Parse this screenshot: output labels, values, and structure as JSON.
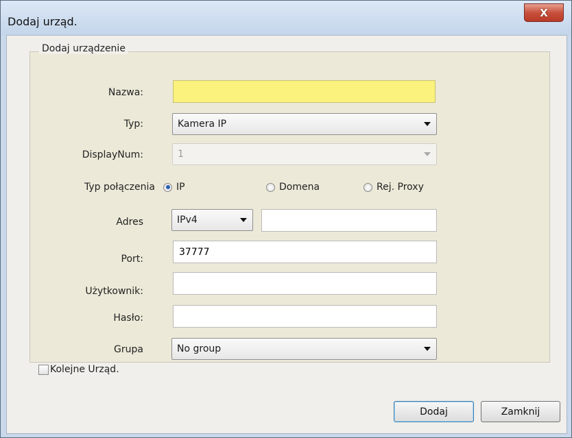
{
  "window": {
    "title": "Dodaj urząd.",
    "close_label": "X"
  },
  "group": {
    "title": "Dodaj urządzenie"
  },
  "fields": {
    "name": {
      "label": "Nazwa:",
      "value": ""
    },
    "type": {
      "label": "Typ:",
      "value": "Kamera IP"
    },
    "display_num": {
      "label": "DisplayNum:",
      "value": "1"
    },
    "connection_type": {
      "label": "Typ połączenia",
      "options": [
        "IP",
        "Domena",
        "Rej. Proxy"
      ],
      "selected": "IP"
    },
    "address": {
      "label": "Adres",
      "protocol": "IPv4",
      "value": ""
    },
    "port": {
      "label": "Port:",
      "value": "37777"
    },
    "user": {
      "label": "Użytkownik:",
      "value": ""
    },
    "password": {
      "label": "Hasło:",
      "value": ""
    },
    "group": {
      "label": "Grupa",
      "value": "No group"
    }
  },
  "footer": {
    "next_label": "Kolejne Urząd.",
    "next_checked": false,
    "add_label": "Dodaj",
    "close_label": "Zamknij"
  },
  "icons": {
    "close": "close-icon",
    "dropdown": "chevron-down-icon"
  }
}
